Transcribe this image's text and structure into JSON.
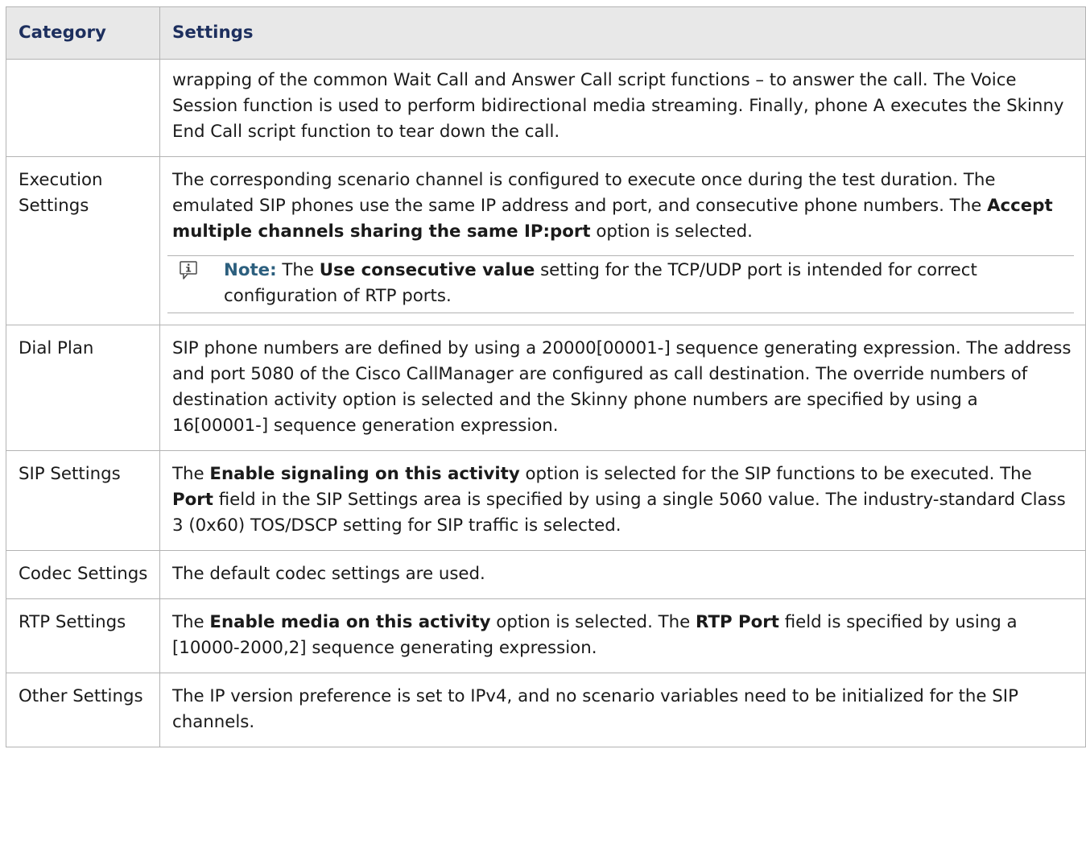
{
  "table": {
    "headers": {
      "category": "Category",
      "settings": "Settings"
    },
    "rows": [
      {
        "category": "",
        "settings": "wrapping of the common Wait Call and Answer Call script functions – to answer the call. The Voice Session function is used to perform bidirectional media streaming. Finally, phone A executes the Skinny End Call script function to tear down the call."
      },
      {
        "category": "Execution Settings",
        "settings_parts": [
          "The corresponding scenario channel is configured to execute once during the test duration. The emulated SIP phones use the same IP address and port, and consecutive phone numbers. The ",
          "Accept multiple channels sharing the same IP:port",
          " option is selected."
        ],
        "note": {
          "icon": "info-note-icon",
          "label": "Note:",
          "parts": [
            " The ",
            "Use consecutive value",
            " setting for the TCP/UDP port is intended for correct configuration of RTP ports."
          ]
        }
      },
      {
        "category": "Dial Plan",
        "settings": "SIP phone numbers are defined by using a 20000[00001-] sequence generating expression. The address and port 5080 of the Cisco CallManager are configured as call destination. The override numbers of destination activity option is selected and the Skinny phone numbers are specified by using a 16[00001-] sequence generation expression."
      },
      {
        "category": "SIP Settings",
        "settings_parts": [
          "The ",
          "Enable signaling on this activity",
          " option is selected for the SIP functions to be executed. The ",
          "Port",
          " field in the SIP Settings area is specified by using a single 5060 value. The industry-standard Class 3 (0x60) TOS/DSCP setting for SIP traffic is selected."
        ]
      },
      {
        "category": "Codec Settings",
        "settings": "The default codec settings are used."
      },
      {
        "category": "RTP Settings",
        "settings_parts": [
          "The ",
          "Enable media on this activity",
          " option is selected. The ",
          "RTP Port",
          " field is specified by using a [10000-2000,2] sequence generating expression."
        ]
      },
      {
        "category": "Other Settings",
        "settings": "The IP version preference is set to IPv4, and no scenario variables need to be initialized for the SIP channels."
      }
    ]
  }
}
